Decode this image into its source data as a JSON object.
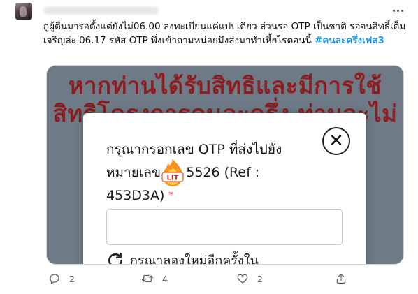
{
  "tweet": {
    "text": "กูผู้ตื่นมารอตั้งแต่ยังไม่06.00 ลงทะเบียนแค่แปปเดียว ส่วนรอ OTP เป็นชาติ รอจนสิทธิ์เต็ม เจริญล่ะ 06.17 รหัส OTP พึ่งเข้าถามหน่อยมึงส่งมาทำเหี้ยไรตอนนี้",
    "hashtag": "#คนละครึ่งเฟส3"
  },
  "media": {
    "banner_line_1": "หากท่านได้รับสิทธิและมีการใช้",
    "banner_line_2": "สิทธิโครงการคนละครึ่ง ท่านจะไม่",
    "dialog": {
      "title": "กรุณากรอกเลข OTP ที่ส่งไปยังหมายเลข 08    5526 (Ref : 453D3A)",
      "required_mark": "*",
      "close_glyph": "✕",
      "otp_value": "",
      "resend_label": "กรุณาลองใหม่อีกครั้งใน"
    },
    "sticker_text": "LIT"
  },
  "actions": {
    "reply_count": "2",
    "retweet_count": "4",
    "like_count": "2"
  },
  "icons": {
    "more": "more-horizontal-icon",
    "reply": "reply-icon",
    "retweet": "retweet-icon",
    "like": "heart-icon",
    "share": "share-icon"
  },
  "colors": {
    "hashtag": "#1d9bf0",
    "icon_gray": "#536471",
    "banner_text": "#8c1d20",
    "required": "#e53935"
  }
}
